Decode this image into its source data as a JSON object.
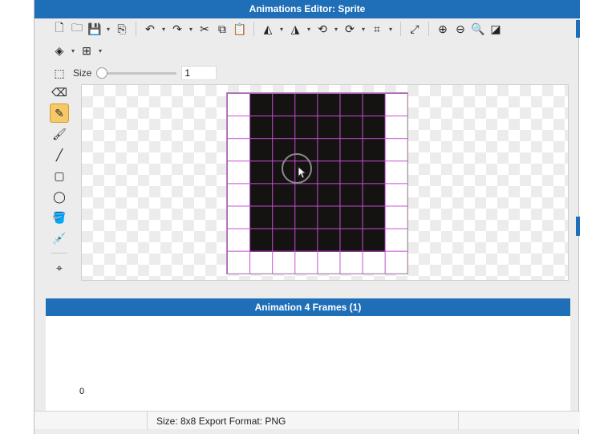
{
  "window": {
    "title": "Animations Editor: Sprite"
  },
  "toolbar": {
    "row1": [
      {
        "name": "new-file-icon",
        "glyph": "🗋"
      },
      {
        "name": "open-folder-icon",
        "glyph": "🗀"
      },
      {
        "name": "save-icon",
        "glyph": "💾"
      },
      {
        "name": "save-menu-chevron-icon",
        "glyph": "▾"
      },
      {
        "name": "export-icon",
        "glyph": "⎘"
      },
      {
        "name": "undo-icon",
        "glyph": "↶"
      },
      {
        "name": "undo-menu-chevron-icon",
        "glyph": "▾"
      },
      {
        "name": "redo-icon",
        "glyph": "↷"
      },
      {
        "name": "redo-menu-chevron-icon",
        "glyph": "▾"
      },
      {
        "name": "cut-icon",
        "glyph": "✂"
      },
      {
        "name": "copy-icon",
        "glyph": "⧉"
      },
      {
        "name": "paste-icon",
        "glyph": "📋"
      },
      {
        "name": "flip-horizontal-icon",
        "glyph": "◭"
      },
      {
        "name": "flip-horizontal-chevron-icon",
        "glyph": "▾"
      },
      {
        "name": "flip-vertical-icon",
        "glyph": "◮"
      },
      {
        "name": "flip-vertical-chevron-icon",
        "glyph": "▾"
      },
      {
        "name": "rotate-left-icon",
        "glyph": "⟲"
      },
      {
        "name": "rotate-left-chevron-icon",
        "glyph": "▾"
      },
      {
        "name": "rotate-right-icon",
        "glyph": "⟳"
      },
      {
        "name": "rotate-right-chevron-icon",
        "glyph": "▾"
      },
      {
        "name": "crop-icon",
        "glyph": "⌗"
      },
      {
        "name": "crop-chevron-icon",
        "glyph": "▾"
      },
      {
        "name": "resize-icon",
        "glyph": "⤢"
      },
      {
        "name": "zoom-in-icon",
        "glyph": "⊕"
      },
      {
        "name": "zoom-out-icon",
        "glyph": "⊖"
      },
      {
        "name": "zoom-fit-icon",
        "glyph": "🔍"
      },
      {
        "name": "fill-background-icon",
        "glyph": "◪"
      }
    ],
    "row2": [
      {
        "name": "layers-icon",
        "glyph": "◈"
      },
      {
        "name": "layers-chevron-icon",
        "glyph": "▾"
      },
      {
        "name": "grid-icon",
        "glyph": "⊞"
      },
      {
        "name": "grid-chevron-icon",
        "glyph": "▾"
      }
    ],
    "size_label": "Size",
    "size_value": "1",
    "size_fraction": 0.0
  },
  "tools": [
    {
      "name": "selection-tool-icon",
      "glyph": "⬚"
    },
    {
      "name": "eraser-tool-icon",
      "glyph": "⌫"
    },
    {
      "name": "pencil-tool-icon",
      "glyph": "✎",
      "active": true
    },
    {
      "name": "brush-tool-icon",
      "glyph": "🖌"
    },
    {
      "name": "line-tool-icon",
      "glyph": "╱"
    },
    {
      "name": "rectangle-tool-icon",
      "glyph": "▢"
    },
    {
      "name": "ellipse-tool-icon",
      "glyph": "◯"
    },
    {
      "name": "paint-bucket-tool-icon",
      "glyph": "🪣"
    },
    {
      "name": "eyedropper-tool-icon",
      "glyph": "💉"
    },
    {
      "name": "origin-tool-icon",
      "glyph": "⌖"
    }
  ],
  "frames": {
    "header": "Animation 4 Frames (1)",
    "frame_index_label": "0"
  },
  "status": {
    "text": "Size: 8x8   Export Format: PNG"
  },
  "colors": {
    "accent": "#1f6fb8",
    "grid": "#c54fd1",
    "sprite_fill": "#141312",
    "active_tool": "#f5c96a"
  }
}
